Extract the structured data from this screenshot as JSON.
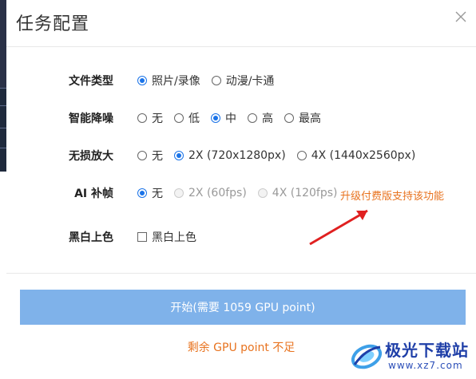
{
  "dialog": {
    "title": "任务配置"
  },
  "settings": {
    "file_type": {
      "label": "文件类型",
      "options": [
        {
          "label": "照片/录像",
          "checked": true
        },
        {
          "label": "动漫/卡通",
          "checked": false
        }
      ]
    },
    "denoise": {
      "label": "智能降噪",
      "options": [
        {
          "label": "无",
          "checked": false
        },
        {
          "label": "低",
          "checked": false
        },
        {
          "label": "中",
          "checked": true
        },
        {
          "label": "高",
          "checked": false
        },
        {
          "label": "最高",
          "checked": false
        }
      ]
    },
    "upscale": {
      "label": "无损放大",
      "options": [
        {
          "label": "无",
          "checked": false
        },
        {
          "label": "2X (720x1280px)",
          "checked": true
        },
        {
          "label": "4X (1440x2560px)",
          "checked": false
        }
      ]
    },
    "frame_interp": {
      "label": "AI 补帧",
      "options": [
        {
          "label": "无",
          "checked": true
        },
        {
          "label": "2X (60fps)",
          "checked": false,
          "disabled": true
        },
        {
          "label": "4X (120fps)",
          "checked": false,
          "disabled": true
        }
      ],
      "upgrade_hint": "升级付费版支持该功能"
    },
    "colorize": {
      "label": "黑白上色",
      "checkbox_label": "黑白上色",
      "checked": false
    }
  },
  "actions": {
    "start_label": "开始(需要 1059 GPU point)",
    "notice": "剩余 GPU point 不足"
  },
  "watermark": {
    "name": "极光下载站",
    "url": "www.xz7.com"
  },
  "colors": {
    "accent": "#1a73e8",
    "button": "#7fb2ea",
    "warning": "#e8731f",
    "arrow": "#e02020"
  }
}
